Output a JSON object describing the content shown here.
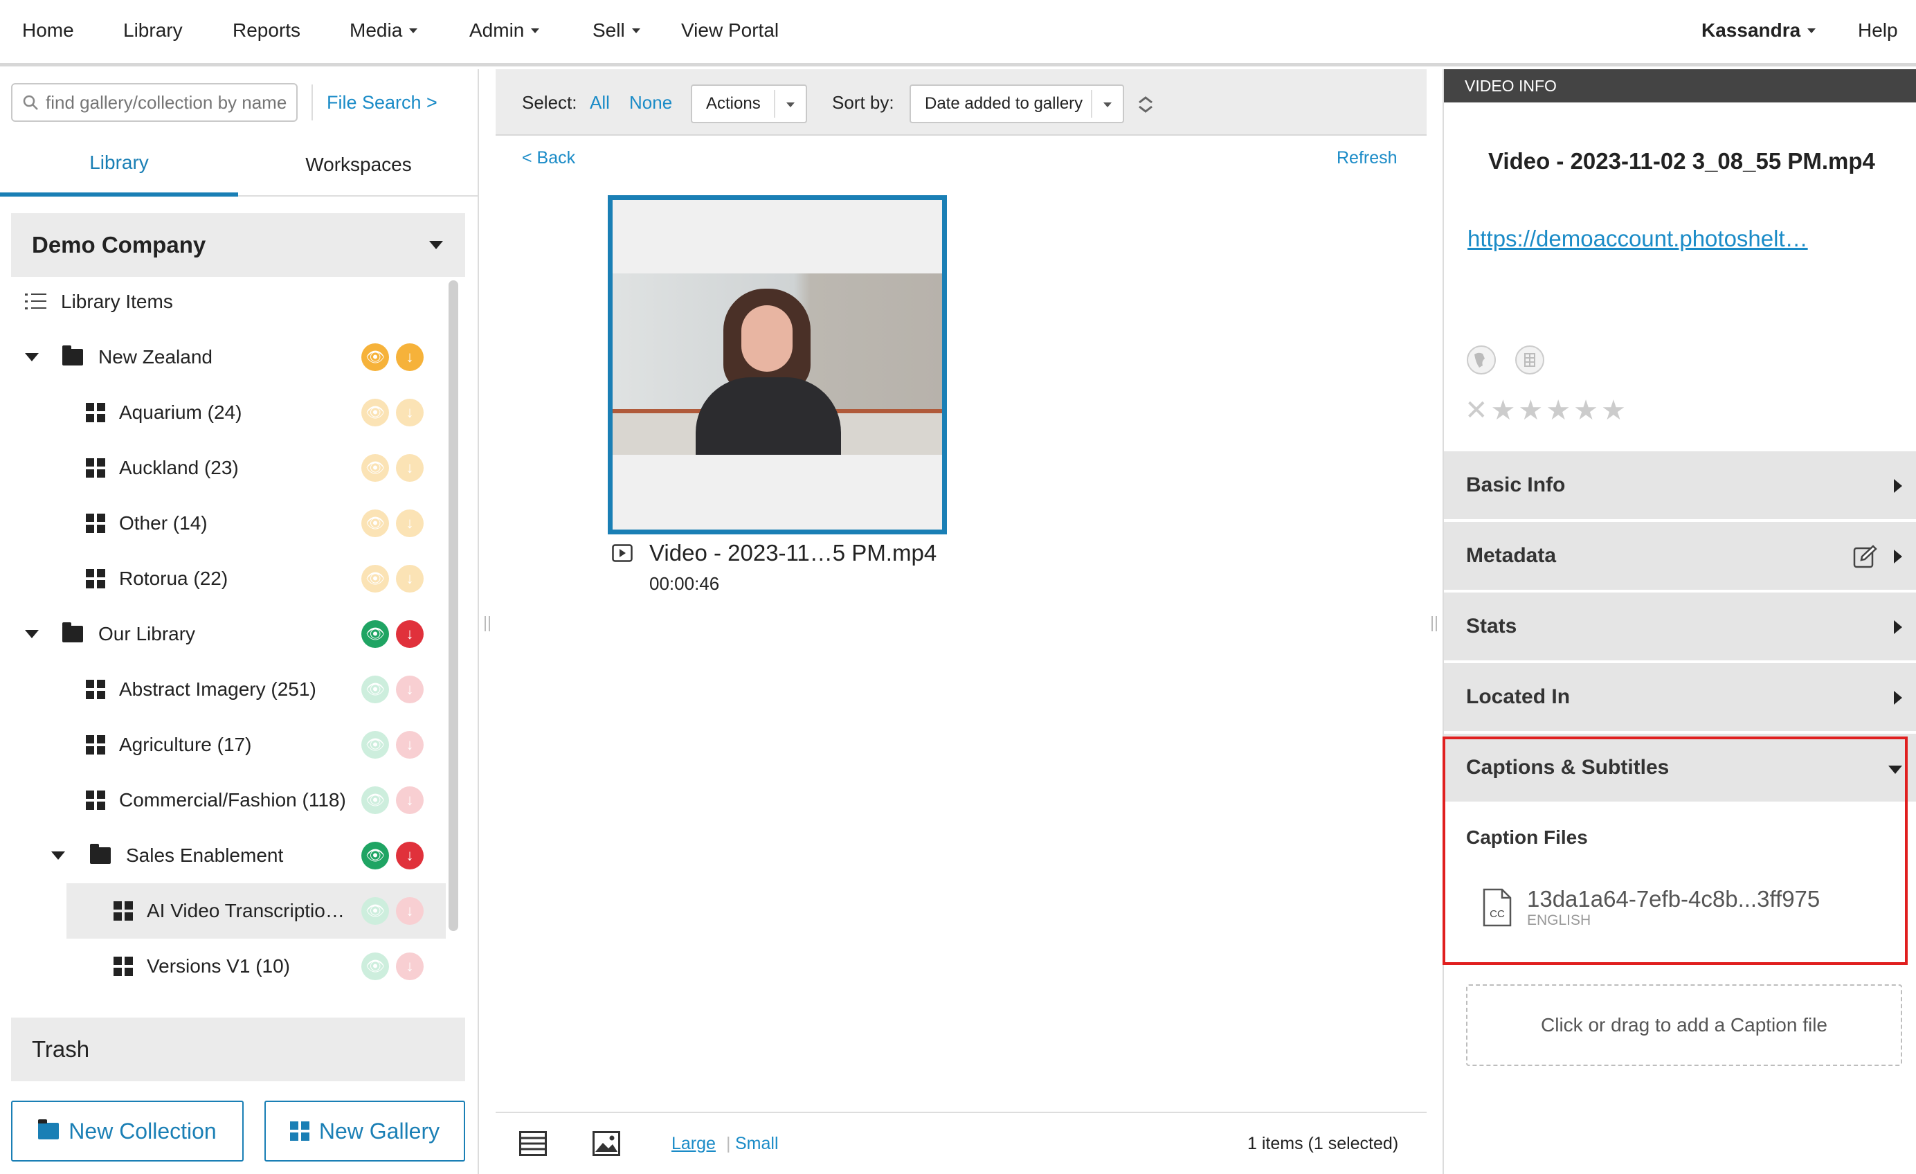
{
  "nav": {
    "home": "Home",
    "library": "Library",
    "reports": "Reports",
    "media": "Media",
    "admin": "Admin",
    "sell": "Sell",
    "view_portal": "View Portal",
    "user": "Kassandra",
    "help": "Help"
  },
  "left": {
    "search_placeholder": "find gallery/collection by name",
    "file_search": "File Search >",
    "tabs": [
      "Library",
      "Workspaces"
    ],
    "company": "Demo Company",
    "library_items": "Library Items",
    "tree": [
      {
        "label": "New Zealand",
        "type": "folder"
      },
      {
        "label": "Aquarium (24)",
        "type": "gallery"
      },
      {
        "label": "Auckland (23)",
        "type": "gallery"
      },
      {
        "label": "Other (14)",
        "type": "gallery"
      },
      {
        "label": "Rotorua (22)",
        "type": "gallery"
      },
      {
        "label": "Our Library",
        "type": "folder"
      },
      {
        "label": "Abstract Imagery (251)",
        "type": "gallery"
      },
      {
        "label": "Agriculture (17)",
        "type": "gallery"
      },
      {
        "label": "Commercial/Fashion (118)",
        "type": "gallery"
      },
      {
        "label": "Sales Enablement",
        "type": "folder"
      },
      {
        "label": "AI Video Transcriptio…",
        "type": "gallery"
      },
      {
        "label": "Versions V1 (10)",
        "type": "gallery"
      }
    ],
    "trash": "Trash",
    "new_collection": "New Collection",
    "new_gallery": "New Gallery",
    "colors": {
      "yellow": "#f6b23a",
      "green": "#1fa463",
      "red": "#e0313b",
      "accent": "#1a7fb5"
    }
  },
  "middle": {
    "select_label": "Select:",
    "all": "All",
    "none": "None",
    "actions": "Actions",
    "sort_label": "Sort by:",
    "sort_value": "Date added to gallery",
    "back": "< Back",
    "refresh": "Refresh",
    "item_title": "Video - 2023-11…5 PM.mp4",
    "item_duration": "00:00:46",
    "size_large": "Large",
    "size_small": "Small",
    "count": "1 items (1 selected)"
  },
  "right": {
    "header": "VIDEO INFO",
    "title": "Video - 2023-11-02 3_08_55 PM.mp4",
    "url": "https://demoaccount.photoshelt…",
    "rating": 0,
    "sections": [
      "Basic Info",
      "Metadata",
      "Stats",
      "Located In"
    ],
    "captions_title": "Captions & Subtitles",
    "caption_files_label": "Caption Files",
    "caption_file_name": "13da1a64-7efb-4c8b...3ff975",
    "caption_file_lang": "ENGLISH",
    "cc_icon_text": "CC",
    "drop_zone": "Click or drag to add a Caption file"
  }
}
